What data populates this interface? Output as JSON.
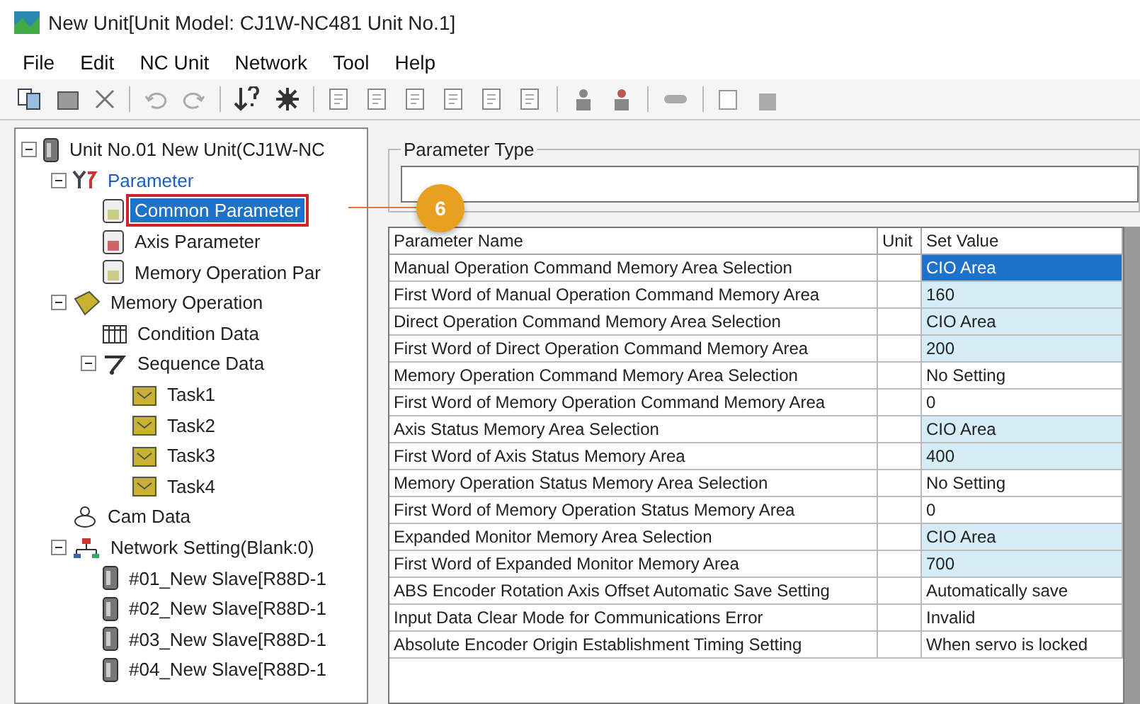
{
  "window": {
    "title": "New Unit[Unit Model: CJ1W-NC481 Unit No.1]"
  },
  "menu": [
    "File",
    "Edit",
    "NC Unit",
    "Network",
    "Tool",
    "Help"
  ],
  "tree": [
    {
      "label": "Unit No.01 New Unit(CJ1W-NC",
      "kind": "unit",
      "expanded": true,
      "selected": false,
      "children": [
        {
          "label": "Parameter",
          "kind": "parameter",
          "expanded": true,
          "selected": false,
          "children": [
            {
              "label": "Common Parameter",
              "kind": "common",
              "selected": true,
              "outlined": true
            },
            {
              "label": "Axis Parameter",
              "kind": "axis",
              "selected": false
            },
            {
              "label": "Memory Operation Par",
              "kind": "memparam",
              "selected": false
            }
          ]
        },
        {
          "label": "Memory Operation",
          "kind": "memory",
          "expanded": true,
          "selected": false,
          "children": [
            {
              "label": "Condition Data",
              "kind": "condition",
              "selected": false
            },
            {
              "label": "Sequence Data",
              "kind": "sequence",
              "expanded": true,
              "selected": false,
              "children": [
                {
                  "label": "Task1",
                  "kind": "task",
                  "selected": false
                },
                {
                  "label": "Task2",
                  "kind": "task",
                  "selected": false
                },
                {
                  "label": "Task3",
                  "kind": "task",
                  "selected": false
                },
                {
                  "label": "Task4",
                  "kind": "task",
                  "selected": false
                }
              ]
            }
          ]
        },
        {
          "label": "Cam Data",
          "kind": "cam",
          "selected": false
        },
        {
          "label": "Network Setting(Blank:0)",
          "kind": "network",
          "expanded": true,
          "selected": false,
          "children": [
            {
              "label": "#01_New Slave[R88D-1",
              "kind": "slave",
              "selected": false
            },
            {
              "label": "#02_New Slave[R88D-1",
              "kind": "slave",
              "selected": false
            },
            {
              "label": "#03_New Slave[R88D-1",
              "kind": "slave",
              "selected": false
            },
            {
              "label": "#04_New Slave[R88D-1",
              "kind": "slave",
              "selected": false
            }
          ]
        }
      ]
    }
  ],
  "parameter_type": {
    "label": "Parameter Type"
  },
  "callout": {
    "badge": "6"
  },
  "table": {
    "columns": [
      "Parameter Name",
      "Unit",
      "Set Value"
    ],
    "rows": [
      {
        "name": "Manual Operation Command Memory Area Selection",
        "value": "CIO Area",
        "selected": true
      },
      {
        "name": "First Word of Manual Operation Command Memory Area",
        "value": "160",
        "highlighted": true,
        "selected": false
      },
      {
        "name": "Direct Operation Command Memory Area Selection",
        "value": "CIO Area",
        "highlighted": true,
        "selected": false
      },
      {
        "name": "First Word of Direct Operation Command Memory Area",
        "value": "200",
        "highlighted": true,
        "selected": false
      },
      {
        "name": "Memory Operation Command Memory Area Selection",
        "value": "No Setting",
        "highlighted": false,
        "selected": false
      },
      {
        "name": "First Word of Memory Operation Command Memory Area",
        "value": "0",
        "highlighted": false,
        "selected": false
      },
      {
        "name": "Axis Status Memory Area Selection",
        "value": "CIO Area",
        "highlighted": true,
        "selected": false
      },
      {
        "name": "First Word of Axis Status Memory Area",
        "value": "400",
        "highlighted": true,
        "selected": false
      },
      {
        "name": "Memory Operation Status Memory Area Selection",
        "value": "No Setting",
        "highlighted": false,
        "selected": false
      },
      {
        "name": "First Word of Memory Operation Status Memory Area",
        "value": "0",
        "highlighted": false,
        "selected": false
      },
      {
        "name": "Expanded Monitor Memory Area Selection",
        "value": "CIO Area",
        "highlighted": true,
        "selected": false
      },
      {
        "name": "First Word of Expanded Monitor Memory Area",
        "value": "700",
        "highlighted": true,
        "selected": false
      },
      {
        "name": "ABS Encoder Rotation Axis Offset Automatic Save Setting",
        "value": "Automatically save",
        "highlighted": false,
        "selected": false
      },
      {
        "name": "Input Data Clear Mode for Communications Error",
        "value": "Invalid",
        "highlighted": false,
        "selected": false
      },
      {
        "name": "Absolute Encoder Origin Establishment Timing Setting",
        "value": "When servo is locked",
        "highlighted": false,
        "selected": false
      }
    ]
  }
}
